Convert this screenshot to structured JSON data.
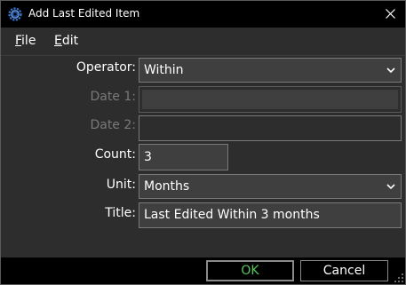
{
  "window": {
    "title": "Add Last Edited Item"
  },
  "menu": {
    "file": {
      "mnemonic": "F",
      "rest": "ile"
    },
    "edit": {
      "mnemonic": "E",
      "rest": "dit"
    }
  },
  "form": {
    "operator": {
      "label": "Operator:",
      "value": "Within"
    },
    "date1": {
      "label": "Date 1:",
      "value": ""
    },
    "date2": {
      "label": "Date 2:",
      "value": ""
    },
    "count": {
      "label": "Count:",
      "value": "3"
    },
    "unit": {
      "label": "Unit:",
      "value": "Months"
    },
    "title": {
      "label": "Title:",
      "value": "Last Edited Within 3 months"
    }
  },
  "buttons": {
    "ok": "OK",
    "cancel": "Cancel"
  },
  "icons": {
    "app": "gear-icon",
    "close": "close-icon",
    "dropdown": "chevron-down-icon",
    "grip": "resize-grip-icon"
  },
  "colors": {
    "ok_text": "#5ec45e",
    "background": "#2d2d2d",
    "field": "#3f3f3f"
  }
}
